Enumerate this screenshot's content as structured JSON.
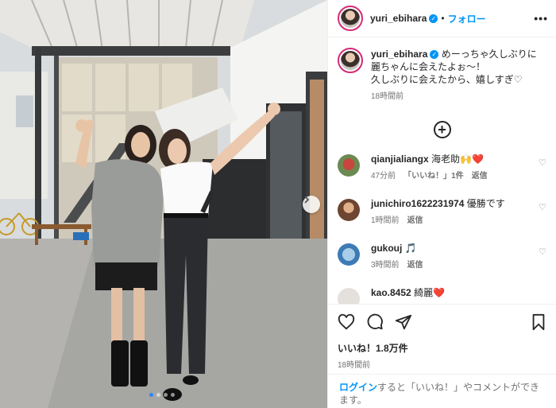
{
  "post": {
    "username": "yuri_ebihara",
    "follow_label": "フォロー",
    "separator": "•",
    "more_label": "•••",
    "caption": {
      "line1": "めーっちゃ久しぶりに",
      "line2": "麗ちゃんに会えたよぉ〜！",
      "line3": "久しぶりに会えたから、嬉しすぎ♡",
      "time": "18時間前"
    },
    "load_more_label": "+",
    "likes": "いいね！1.8万件",
    "time": "18時間前"
  },
  "comments": [
    {
      "user": "qianjialiangx",
      "text": "海老助🙌❤️",
      "time": "47分前",
      "likes": "「いいね！」1件",
      "reply": "返信",
      "avatar_color": "#b5453c"
    },
    {
      "user": "junichiro1622231974",
      "text": "優勝です",
      "time": "1時間前",
      "likes": "",
      "reply": "返信",
      "avatar_color": "#8a5a3c"
    },
    {
      "user": "gukouj",
      "text": "🎵",
      "time": "3時間前",
      "likes": "",
      "reply": "返信",
      "avatar_color": "#6fa7d6"
    },
    {
      "user": "kao.8452",
      "text": "綺麗❤️",
      "time": "",
      "likes": "",
      "reply": "",
      "avatar_color": "#d9d4cf"
    }
  ],
  "login_bar": {
    "login_label": "ログイン",
    "text": "すると「いいね！」やコメントができます。"
  },
  "carousel": {
    "slide_count": 4,
    "active_index": 1
  },
  "colors": {
    "accent": "#0095f6",
    "carousel_dot": "#2d86ff",
    "avatar_ring": "#d62976"
  },
  "icons": [
    "verified-badge-icon",
    "heart-icon",
    "comment-icon",
    "share-icon",
    "bookmark-icon",
    "next-arrow-icon",
    "plus-circle-icon"
  ]
}
